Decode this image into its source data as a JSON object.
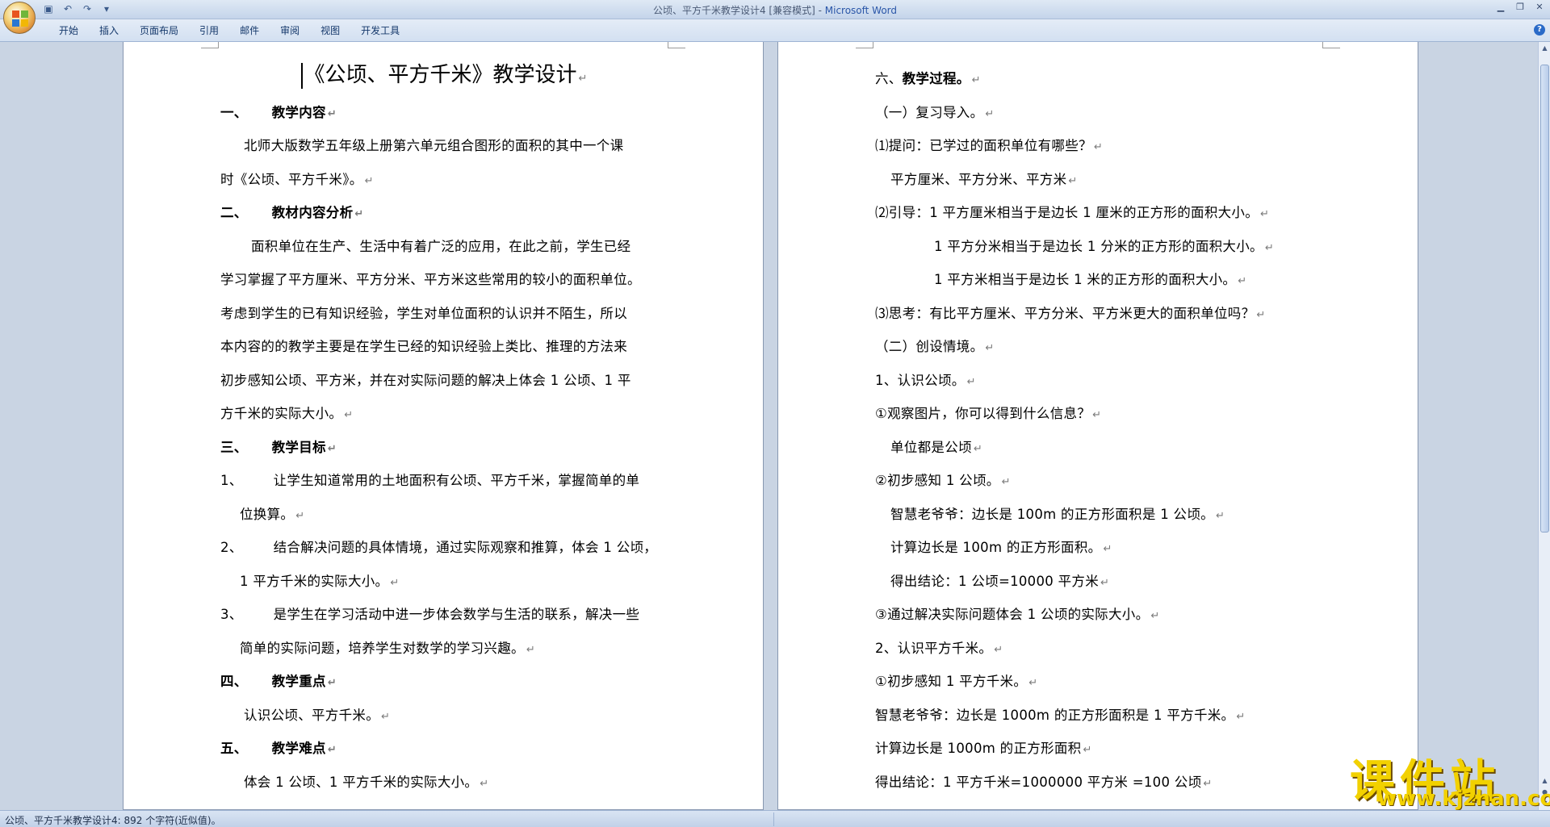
{
  "window": {
    "title": "公顷、平方千米教学设计4 [兼容模式]",
    "separator": " - ",
    "app": "Microsoft Word"
  },
  "ribbon": {
    "tabs": [
      "开始",
      "插入",
      "页面布局",
      "引用",
      "邮件",
      "审阅",
      "视图",
      "开发工具"
    ]
  },
  "left_page": {
    "title": "《公顷、平方千米》教学设计",
    "s1_num": "一、",
    "s1_title": "教学内容",
    "p1a": "北师大版数学五年级上册第六单元组合图形的面积的其中一个课",
    "p1b": "时《公顷、平方千米》。",
    "s2_num": "二、",
    "s2_title": "教材内容分析",
    "p2a": "面积单位在生产、生活中有着广泛的应用，在此之前，学生已经",
    "p2b": "学习掌握了平方厘米、平方分米、平方米这些常用的较小的面积单位。",
    "p2c": "考虑到学生的已有知识经验，学生对单位面积的认识并不陌生，所以",
    "p2d": "本内容的的教学主要是在学生已经的知识经验上类比、推理的方法来",
    "p2e": "初步感知公顷、平方米，并在对实际问题的解决上体会 1 公顷、1 平",
    "p2f": "方千米的实际大小。",
    "s3_num": "三、",
    "s3_title": "教学目标",
    "g1_num": "1、",
    "g1a": "让学生知道常用的土地面积有公顷、平方千米，掌握简单的单",
    "g1b": "位换算。",
    "g2_num": "2、",
    "g2a": "结合解决问题的具体情境，通过实际观察和推算，体会 1 公顷，",
    "g2b": "1 平方千米的实际大小。",
    "g3_num": "3、",
    "g3a": "是学生在学习活动中进一步体会数学与生活的联系，解决一些",
    "g3b": "简单的实际问题，培养学生对数学的学习兴趣。",
    "s4_num": "四、",
    "s4_title": "教学重点",
    "p4": "认识公顷、平方千米。",
    "s5_num": "五、",
    "s5_title": "教学难点",
    "p5": "体会 1 公顷、1 平方千米的实际大小。"
  },
  "right_page": {
    "s6_num": "六、",
    "s6_title": "教学过程。",
    "r1": "（一）复习导入。",
    "r2": "⑴提问：已学过的面积单位有哪些？",
    "r3": "平方厘米、平方分米、平方米",
    "r4": "⑵引导：1 平方厘米相当于是边长 1 厘米的正方形的面积大小。",
    "r5": "1 平方分米相当于是边长 1 分米的正方形的面积大小。",
    "r6": "1 平方米相当于是边长 1 米的正方形的面积大小。",
    "r7": "⑶思考：有比平方厘米、平方分米、平方米更大的面积单位吗？",
    "r8": "（二）创设情境。",
    "r9": "1、认识公顷。",
    "r10": "①观察图片，你可以得到什么信息？",
    "r11": "单位都是公顷",
    "r12": "②初步感知 1 公顷。",
    "r13": "智慧老爷爷：边长是 100m 的正方形面积是 1 公顷。",
    "r14": "计算边长是 100m 的正方形面积。",
    "r15": "得出结论：1 公顷=10000 平方米",
    "r16": "③通过解决实际问题体会 1 公顷的实际大小。",
    "r17": "2、认识平方千米。",
    "r18": "①初步感知 1 平方千米。",
    "r19": "智慧老爷爷：边长是 1000m 的正方形面积是 1 平方千米。",
    "r20": "计算边长是 1000m 的正方形面积",
    "r21": "得出结论：1 平方千米=1000000 平方米 =100 公顷"
  },
  "status_bar": {
    "text": "公顷、平方千米教学设计4: 892 个字符(近似值)。"
  },
  "watermark": {
    "cn": "课件站",
    "url": "www.kjzhan.com"
  },
  "paragraph_mark": "↵",
  "colors": {
    "watermark": "#f2d100",
    "ribbon_text": "#15386b",
    "app_title": "#2a56a8"
  }
}
